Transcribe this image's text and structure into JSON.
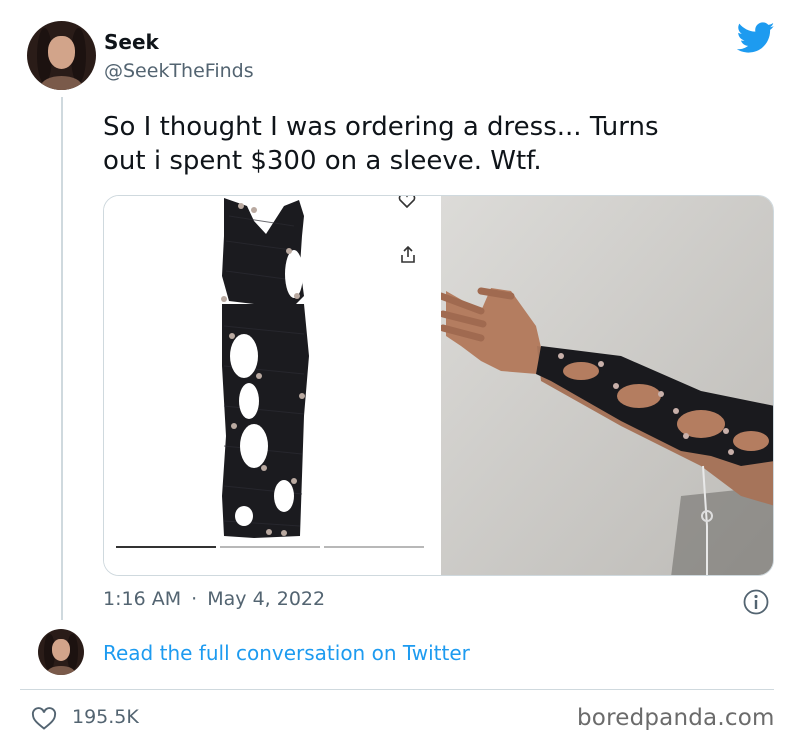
{
  "author": {
    "name": "Seek",
    "handle": "@SeekTheFinds"
  },
  "tweet": {
    "text_line1": "So I thought I was ordering a dress... Turns",
    "text_line2": "out i spent $300 on a sleeve. Wtf.",
    "time": "1:16 AM",
    "separator": "·",
    "date": "May 4, 2022"
  },
  "media": {
    "left_image": "product photo of black cut-out knit garment with beads",
    "right_image": "photo of arm wearing black cut-out sleeve with beads",
    "carousel_dots": 3,
    "active_dot": 0
  },
  "conversation_link": "Read the full conversation on Twitter",
  "engagement": {
    "likes": "195.5K"
  },
  "watermark": "boredpanda.com",
  "icons": {
    "brand": "twitter-bird-icon",
    "info": "info-icon",
    "heart": "heart-icon",
    "heart_product": "heart-outline-icon",
    "share_product": "share-icon"
  },
  "colors": {
    "twitter_blue": "#1d9bf0",
    "text_primary": "#0f1419",
    "text_secondary": "#536471",
    "border": "#cfd9de"
  }
}
